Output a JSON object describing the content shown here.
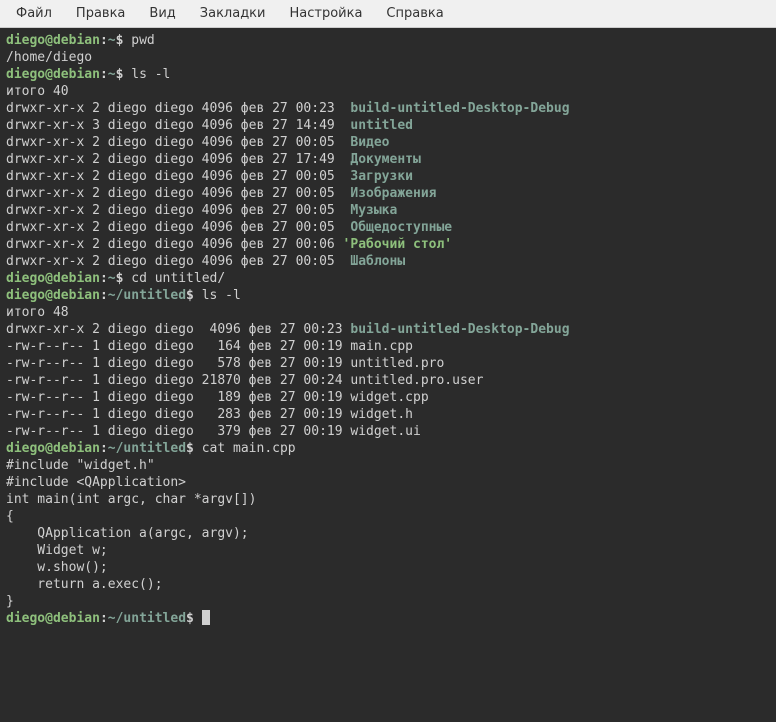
{
  "menu": {
    "items": [
      "Файл",
      "Правка",
      "Вид",
      "Закладки",
      "Настройка",
      "Справка"
    ]
  },
  "prompt": {
    "user": "diego",
    "at": "@",
    "host": "debian",
    "colon": ":",
    "home_path": "~",
    "untitled_path": "~/untitled",
    "dollar": "$"
  },
  "cmd1": "pwd",
  "out1": "/home/diego",
  "cmd2": "ls -l",
  "ls1_total": "итого 40",
  "ls1": [
    {
      "row": "drwxr-xr-x 2 diego diego 4096 фев 27 00:23  ",
      "name": "build-untitled-Desktop-Debug",
      "type": "dir"
    },
    {
      "row": "drwxr-xr-x 3 diego diego 4096 фев 27 14:49  ",
      "name": "untitled",
      "type": "dir"
    },
    {
      "row": "drwxr-xr-x 2 diego diego 4096 фев 27 00:05  ",
      "name": "Видео",
      "type": "dir"
    },
    {
      "row": "drwxr-xr-x 2 diego diego 4096 фев 27 17:49  ",
      "name": "Документы",
      "type": "dir"
    },
    {
      "row": "drwxr-xr-x 2 diego diego 4096 фев 27 00:05  ",
      "name": "Загрузки",
      "type": "dir"
    },
    {
      "row": "drwxr-xr-x 2 diego diego 4096 фев 27 00:05  ",
      "name": "Изображения",
      "type": "dir"
    },
    {
      "row": "drwxr-xr-x 2 diego diego 4096 фев 27 00:05  ",
      "name": "Музыка",
      "type": "dir"
    },
    {
      "row": "drwxr-xr-x 2 diego diego 4096 фев 27 00:05  ",
      "name": "Общедоступные",
      "type": "dir"
    },
    {
      "row": "drwxr-xr-x 2 diego diego 4096 фев 27 00:06 ",
      "name": "'Рабочий стол'",
      "type": "quoted"
    },
    {
      "row": "drwxr-xr-x 2 diego diego 4096 фев 27 00:05  ",
      "name": "Шаблоны",
      "type": "dir"
    }
  ],
  "cmd3": "cd untitled/",
  "cmd4": "ls -l",
  "ls2_total": "итого 48",
  "ls2": [
    {
      "row": "drwxr-xr-x 2 diego diego  4096 фев 27 00:23 ",
      "name": "build-untitled-Desktop-Debug",
      "type": "dir"
    },
    {
      "row": "-rw-r--r-- 1 diego diego   164 фев 27 00:19 ",
      "name": "main.cpp",
      "type": "file"
    },
    {
      "row": "-rw-r--r-- 1 diego diego   578 фев 27 00:19 ",
      "name": "untitled.pro",
      "type": "file"
    },
    {
      "row": "-rw-r--r-- 1 diego diego 21870 фев 27 00:24 ",
      "name": "untitled.pro.user",
      "type": "file"
    },
    {
      "row": "-rw-r--r-- 1 diego diego   189 фев 27 00:19 ",
      "name": "widget.cpp",
      "type": "file"
    },
    {
      "row": "-rw-r--r-- 1 diego diego   283 фев 27 00:19 ",
      "name": "widget.h",
      "type": "file"
    },
    {
      "row": "-rw-r--r-- 1 diego diego   379 фев 27 00:19 ",
      "name": "widget.ui",
      "type": "file"
    }
  ],
  "cmd5": "cat main.cpp",
  "cat_lines": [
    "#include \"widget.h\"",
    "",
    "#include <QApplication>",
    "",
    "int main(int argc, char *argv[])",
    "{",
    "    QApplication a(argc, argv);",
    "    Widget w;",
    "    w.show();",
    "    return a.exec();",
    "}"
  ]
}
